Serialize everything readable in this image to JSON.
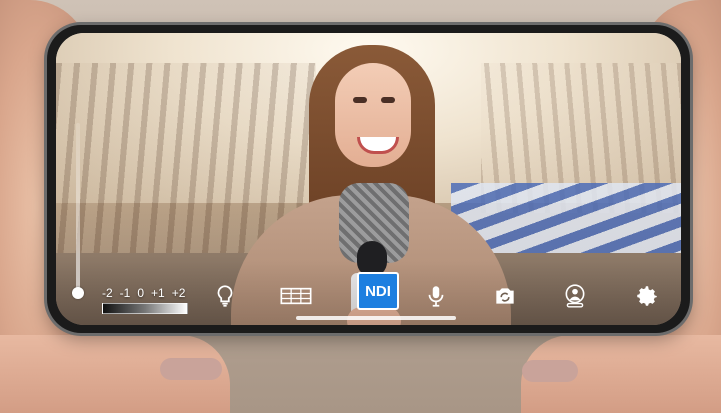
{
  "camera_ui": {
    "exposure": {
      "labels": [
        "-2",
        "-1",
        "0",
        "+1",
        "+2"
      ]
    },
    "tools": {
      "flashlight_icon": "lightbulb-icon",
      "grid_icon": "grid-icon",
      "ndi_label": "NDI",
      "mic_icon": "microphone-icon",
      "switch_camera_icon": "switch-camera-icon",
      "remote_user_icon": "remote-user-icon",
      "settings_icon": "gear-icon"
    },
    "accent_color": "#1d7fe0"
  }
}
